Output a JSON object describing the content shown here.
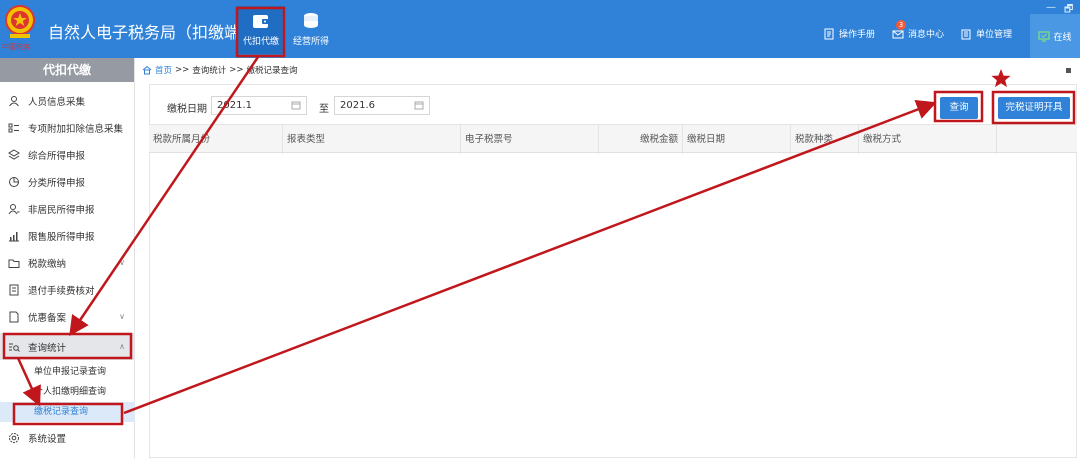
{
  "header": {
    "title": "自然人电子税务局（扣缴端）",
    "emblem_text": "中国税务",
    "tabs": [
      {
        "label": "代扣代缴",
        "icon": "wallet-icon",
        "active": true
      },
      {
        "label": "经营所得",
        "icon": "coins-icon",
        "active": false
      }
    ],
    "right_items": [
      {
        "label": "操作手册",
        "icon": "manual-icon"
      },
      {
        "label": "消息中心",
        "icon": "mail-icon",
        "badge": "3"
      },
      {
        "label": "单位管理",
        "icon": "building-icon"
      }
    ],
    "online_label": "在线",
    "window_controls": [
      "—",
      "🗗"
    ]
  },
  "sidebar": {
    "title": "代扣代缴",
    "items": [
      {
        "label": "人员信息采集",
        "icon": "person-icon"
      },
      {
        "label": "专项附加扣除信息采集",
        "icon": "list-icon"
      },
      {
        "label": "综合所得申报",
        "icon": "layers-icon"
      },
      {
        "label": "分类所得申报",
        "icon": "pie-icon"
      },
      {
        "label": "非居民所得申报",
        "icon": "user-globe-icon"
      },
      {
        "label": "限售股所得申报",
        "icon": "bar-chart-icon"
      },
      {
        "label": "税款缴纳",
        "icon": "folder-icon",
        "chevron": "∨"
      },
      {
        "label": "退付手续费核对",
        "icon": "receipt-icon"
      },
      {
        "label": "优惠备案",
        "icon": "document-icon",
        "chevron": "∨"
      },
      {
        "label": "查询统计",
        "icon": "search-list-icon",
        "chevron": "∧",
        "active": true
      },
      {
        "label": "系统设置",
        "icon": "gear-icon"
      }
    ],
    "subitems": [
      {
        "label": "单位申报记录查询"
      },
      {
        "label": "个人扣缴明细查询"
      },
      {
        "label": "缴税记录查询",
        "active": true
      }
    ]
  },
  "breadcrumb": {
    "home": "首页",
    "sep": ">>",
    "level1": "查询统计",
    "level2": "缴税记录查询"
  },
  "filter": {
    "label": "缴税日期",
    "start": "2021.1",
    "to": "至",
    "end": "2021.6"
  },
  "buttons": {
    "query": "查询",
    "certificate": "完税证明开具"
  },
  "table": {
    "columns": [
      "税款所属月份",
      "报表类型",
      "电子税票号",
      "缴税金额",
      "缴税日期",
      "税款种类",
      "缴税方式"
    ],
    "rows": []
  },
  "annotation": {
    "star_color": "#c0171c",
    "box_color": "#c0171c"
  }
}
